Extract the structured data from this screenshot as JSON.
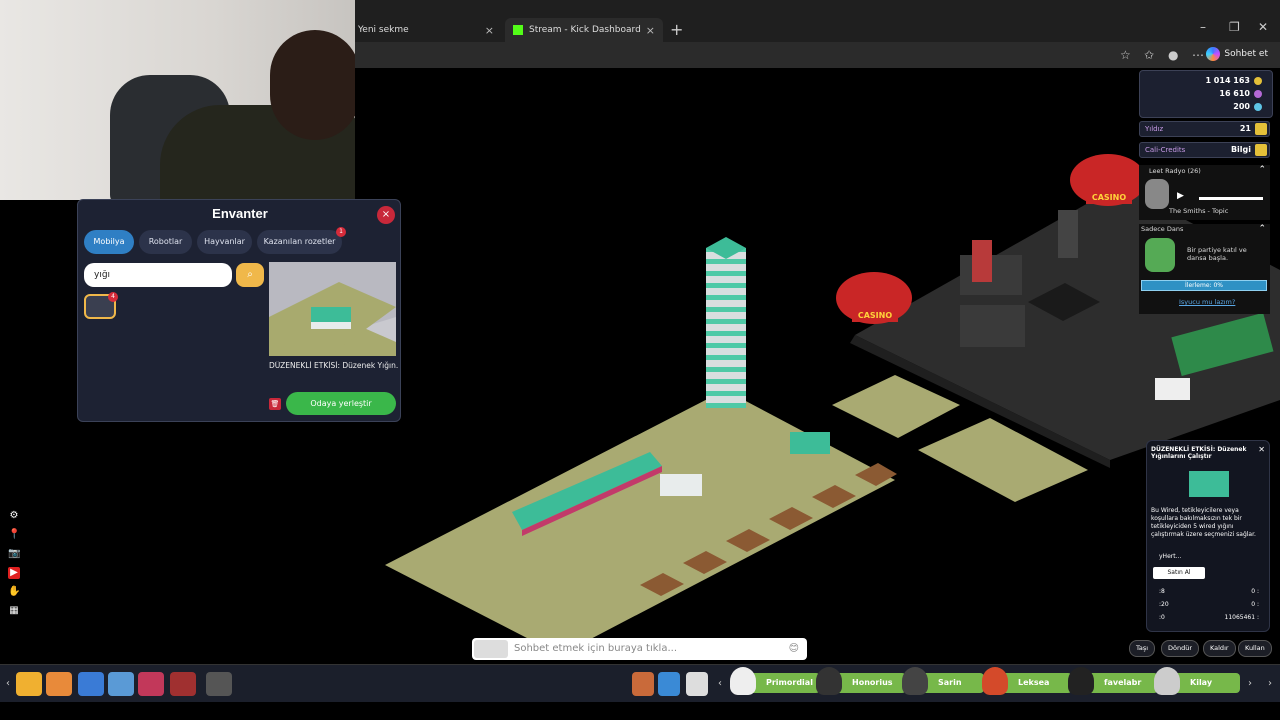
{
  "browser": {
    "tabs": [
      {
        "label": "Yeni sekme",
        "close": "×"
      },
      {
        "label": "Stream - Kick Dashboard",
        "close": "×"
      }
    ],
    "new_tab": "+",
    "window_controls": [
      "–",
      "❐",
      "✕"
    ],
    "copilot_label": "Sohbet et"
  },
  "inventory": {
    "title": "Envanter",
    "close": "×",
    "tabs": [
      "Mobilya",
      "Robotlar",
      "Hayvanlar",
      "Kazanılan rozetler"
    ],
    "badge_count": "1",
    "search_value": "yığı",
    "slot_count": "4",
    "item_name": "DÜZENEKLİ ETKİSİ: Düzenek Yığın...",
    "place_button": "Odaya yerleştir"
  },
  "currency": {
    "credits": "1 014 163",
    "duckets": "16 610",
    "diamonds": "200"
  },
  "stats": {
    "stars_label": "Yıldız",
    "stars_value": "21",
    "credits_label": "Cali-Credits",
    "credits_value": "Bilgi"
  },
  "radio": {
    "title": "Leet Radyo (26)",
    "track": "The Smiths - Topic"
  },
  "dans": {
    "title": "Sadece Dans",
    "text": "Bir partiye katıl ve dansa başla.",
    "progress": "İlerleme: 0%",
    "progress_value": 0,
    "link": "Isyucu mu lazım?"
  },
  "wired": {
    "title": "DÜZENEKLİ ETKİSİ: Düzenek Yığınlarını Çalıştır",
    "description": "Bu Wired, tetikleyicilere veya koşullara bakılmaksızın tek bir tetikleyiciden 5 wired yığını çalıştırmak üzere seçmenizi sağlar.",
    "owner": "yHert...",
    "buy_button": "Satın Al",
    "stat_left": [
      ":8",
      ":20",
      ":0"
    ],
    "stat_right": [
      "0 :",
      "0 :",
      "11065461 :"
    ]
  },
  "actions": [
    "Taşı",
    "Döndür",
    "Kaldır",
    "Kullan"
  ],
  "chat": {
    "placeholder": "Sohbet etmek için buraya tıkla..."
  },
  "friends": [
    "Primordial",
    "Honorius",
    "Sarin",
    "Leksea",
    "favelabr",
    "Kilay"
  ],
  "game_labels": {
    "casino_1": "CASINO",
    "casino_2": "CASINO"
  }
}
